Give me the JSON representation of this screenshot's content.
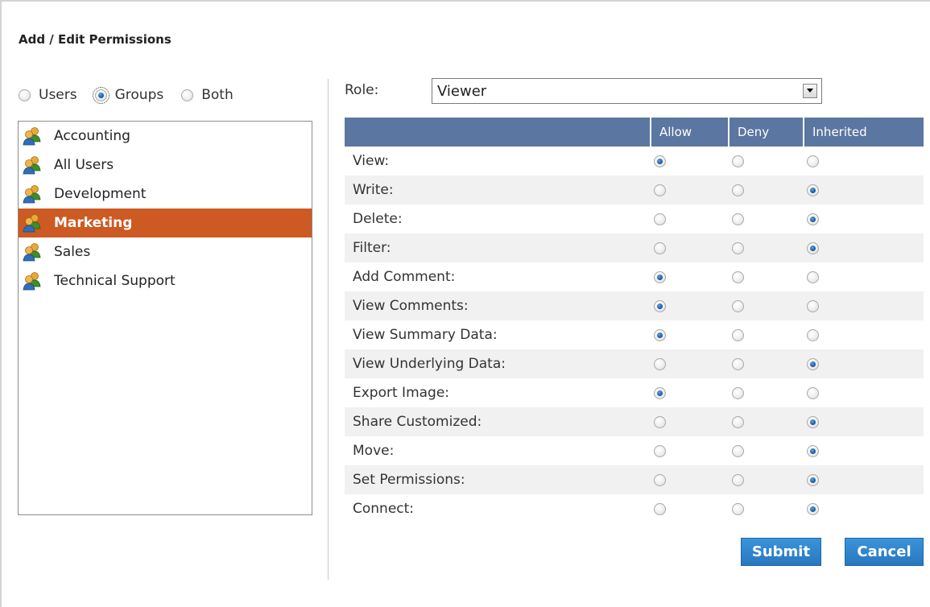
{
  "dialog": {
    "title": "Add / Edit Permissions"
  },
  "member_type": {
    "options": [
      {
        "label": "Users",
        "selected": false
      },
      {
        "label": "Groups",
        "selected": true
      },
      {
        "label": "Both",
        "selected": false
      }
    ]
  },
  "groups": {
    "items": [
      "Accounting",
      "All Users",
      "Development",
      "Marketing",
      "Sales",
      "Technical Support"
    ],
    "selected": "Marketing"
  },
  "role": {
    "label": "Role:",
    "value": "Viewer"
  },
  "permissions": {
    "columns": [
      "Allow",
      "Deny",
      "Inherited"
    ],
    "rows": [
      {
        "name": "View:",
        "state": "Allow"
      },
      {
        "name": "Write:",
        "state": "Inherited"
      },
      {
        "name": "Delete:",
        "state": "Inherited"
      },
      {
        "name": "Filter:",
        "state": "Inherited"
      },
      {
        "name": "Add Comment:",
        "state": "Allow"
      },
      {
        "name": "View Comments:",
        "state": "Allow"
      },
      {
        "name": "View Summary Data:",
        "state": "Allow"
      },
      {
        "name": "View Underlying Data:",
        "state": "Inherited"
      },
      {
        "name": "Export Image:",
        "state": "Allow"
      },
      {
        "name": "Share Customized:",
        "state": "Inherited"
      },
      {
        "name": "Move:",
        "state": "Inherited"
      },
      {
        "name": "Set Permissions:",
        "state": "Inherited"
      },
      {
        "name": "Connect:",
        "state": "Inherited"
      }
    ]
  },
  "buttons": {
    "submit": "Submit",
    "cancel": "Cancel"
  },
  "colors": {
    "selected_row": "#cc5a22",
    "table_header": "#5b76a0",
    "button": "#2f86cc"
  },
  "icons": {
    "group": "group-icon",
    "dropdown": "chevron-down-icon"
  }
}
